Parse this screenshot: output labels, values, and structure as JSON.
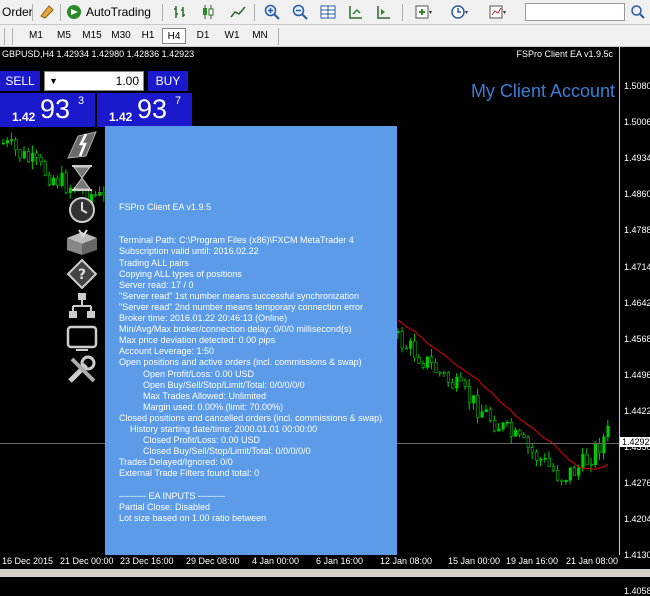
{
  "toolbar": {
    "order_label": "Order",
    "autotrading_label": "AutoTrading"
  },
  "timeframes": [
    "M1",
    "M5",
    "M15",
    "M30",
    "H1",
    "H4",
    "D1",
    "W1",
    "MN"
  ],
  "active_timeframe": "H4",
  "chart": {
    "symbol_info": "GBPUSD,H4  1.42934 1.42980 1.42836 1.42923",
    "ea_name": "FSPro Client EA v1.9.5c",
    "client_label": "My Client Account",
    "current_price_label": "1.4292",
    "price_labels": [
      "1.5080",
      "1.5006",
      "1.4934",
      "1.4860",
      "1.4788",
      "1.4714",
      "1.4642",
      "1.4568",
      "1.4496",
      "1.4422",
      "1.4350",
      "1.4276",
      "1.4204",
      "1.4130",
      "1.4058"
    ],
    "time_labels": [
      "16 Dec 2015",
      "21 Dec 00:00",
      "23 Dec 16:00",
      "29 Dec 08:00",
      "4 Jan 00:00",
      "6 Jan 16:00",
      "12 Jan 08:00",
      "15 Jan 00:00",
      "19 Jan 16:00",
      "21 Jan 08:00"
    ]
  },
  "trade": {
    "sell_label": "SELL",
    "buy_label": "BUY",
    "lot": "1.00",
    "sell_prefix": "1.42",
    "sell_big": "93",
    "sell_sup": "3",
    "buy_prefix": "1.42",
    "buy_big": "93",
    "buy_sup": "7"
  },
  "icons": [
    "lightning-icon",
    "hourglass-icon",
    "clock-icon",
    "box-icon",
    "help-icon",
    "network-icon",
    "display-icon",
    "tools-icon"
  ],
  "panel": {
    "lines": [
      "FSPro Client EA  v1.9.5",
      "",
      "",
      "Terminal Path: C:\\Program Files (x86)\\FXCM MetaTrader 4",
      "Subscription valid until: 2016.02.22",
      "Trading ALL pairs",
      "Copying ALL types of positions",
      "Server read: 17 / 0",
      "\"Server read\" 1st number means successful synchronization",
      "\"Server read\" 2nd number means temporary connection error",
      "Broker time: 2016.01.22 20:46:13 (Online)",
      "Min/Avg/Max broker/connection delay: 0/0/0 millisecond(s)",
      "Max price deviation detected: 0.00 pips",
      "Account Leverage: 1:50",
      "Open positions and active orders (incl. commissions & swap)",
      "Open Profit/Loss: 0.00 USD",
      "Open Buy/Sell/Stop/Limit/Total: 0/0/0/0/0",
      "Max Trades Allowed: Unlimited",
      "Margin used: 0.00% (limit: 70.00%)",
      "Closed positions and cancelled orders (incl. commissions & swap)",
      "History starting date/time: 2000.01.01 00:00:00",
      "Closed Profit/Loss: 0.00 USD",
      "Closed Buy/Sell/Stop/Limit/Total: 0/0/0/0/0",
      "Trades Delayed/Ignored: 0/0",
      "External Trade Filters found total: 0",
      "",
      "--------- EA INPUTS ---------",
      "Partial Close: Disabled",
      "Lot size based on 1.00 ratio between"
    ]
  },
  "colors": {
    "trade_blue": "#1a1acc",
    "panel_blue": "#5b9be8",
    "candle_green": "#00c800",
    "ma_red": "#e00000",
    "client_text": "#3a7fd5"
  }
}
